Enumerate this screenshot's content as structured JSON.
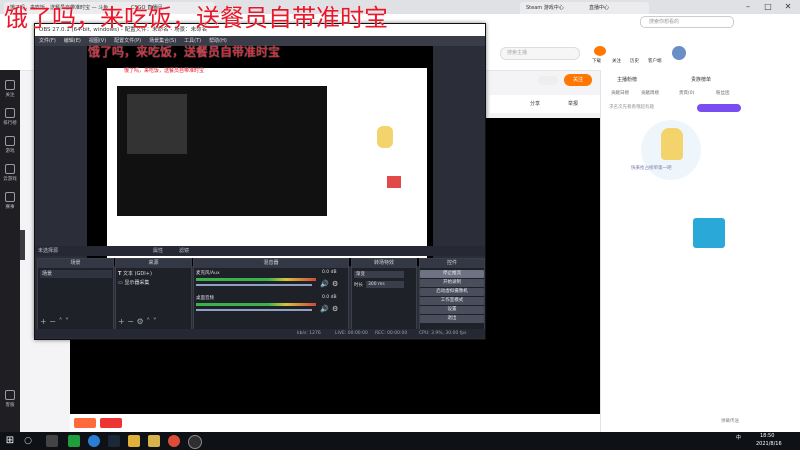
{
  "browser": {
    "tabs": [
      "饿了吗，来吃饭，送餐员自带准时宝 — 斗鱼",
      "CSGO 直播间",
      "Steam 游戏中心",
      "直播中心"
    ],
    "address": "douyu.com",
    "search_placeholder": "搜索直播间ID",
    "addr_search_placeholder": "搜索你想看的"
  },
  "overlay_text": "饿了吗，来吃饭，送餐员自带准时宝",
  "overlay_text_small": "饿了吗，来吃饭，送餐员自带准时宝",
  "overlay_text_tiny": "饿了吗，来吃饭，送餐员自带准时宝",
  "left_rail": [
    {
      "label": "关注",
      "icon": "heart-icon"
    },
    {
      "label": "排行榜",
      "icon": "rank-icon"
    },
    {
      "label": "游戏",
      "icon": "game-icon"
    },
    {
      "label": "云游戏",
      "icon": "cloud-icon"
    },
    {
      "label": "赛事",
      "icon": "trophy-icon"
    },
    {
      "label": "客服",
      "icon": "service-icon"
    }
  ],
  "site_header": {
    "search_placeholder": "搜索主播",
    "nav": [
      "下载",
      "关注",
      "历史",
      "客户端",
      "消息"
    ]
  },
  "player_bar": {
    "share": "分享",
    "report": "举报",
    "follow": "关注"
  },
  "right_panel": {
    "tabs": [
      "主播粉榜",
      "贵族榜单"
    ],
    "subtabs": [
      "贡献日榜",
      "贡献周榜",
      "贵宾(0)",
      "粉丝团"
    ],
    "hint": "求名次先看看哦超有趣",
    "empty": "快来抢占榜单第一吧",
    "footer": "弹幕传送"
  },
  "obs": {
    "title": "OBS 27.0.1 (64-bit, windows) - 配置文件：未命名 - 场景：未命名",
    "menu": [
      "文件(F)",
      "编辑(E)",
      "视图(V)",
      "配置文件(P)",
      "场景集合(S)",
      "工具(T)",
      "帮助(H)"
    ],
    "scene_collection_label": "未选择源",
    "props_label": "属性",
    "filters_label": "滤镜",
    "scenes_header": "场景",
    "scenes": [
      "场景"
    ],
    "sources_header": "来源",
    "sources": [
      "文本 (GDI+)",
      "显示器采集"
    ],
    "mixer_header": "混音器",
    "mixer": [
      {
        "name": "麦克风/Aux",
        "db": "0.0 dB"
      },
      {
        "name": "桌面音频",
        "db": "0.0 dB"
      }
    ],
    "transition_header": "转场特效",
    "transition_type": "渐变",
    "duration_label": "时长",
    "duration_value": "300 ms",
    "controls_header": "控件",
    "controls": [
      "停止推流",
      "开始录制",
      "启动虚拟摄像机",
      "工作室模式",
      "设置",
      "退出"
    ],
    "status": {
      "live": "LIVE: 00:00:00",
      "rec": "REC: 00:00:00",
      "cpu": "CPU: 3.9%, 30.00 fps",
      "kbps": "kb/s: 1276"
    }
  },
  "taskbar": {
    "time": "18:50",
    "date": "2021/8/16",
    "lang": "中",
    "icons": [
      "windows-icon",
      "search-icon",
      "taskview-icon",
      "explorer-icon",
      "edge-icon",
      "steam-icon",
      "folder-icon",
      "chrome-icon",
      "obs-icon"
    ]
  },
  "colors": {
    "overlay_red": "#e8172a",
    "douyu_orange": "#ff7700",
    "obs_bg": "#2b2e38"
  }
}
